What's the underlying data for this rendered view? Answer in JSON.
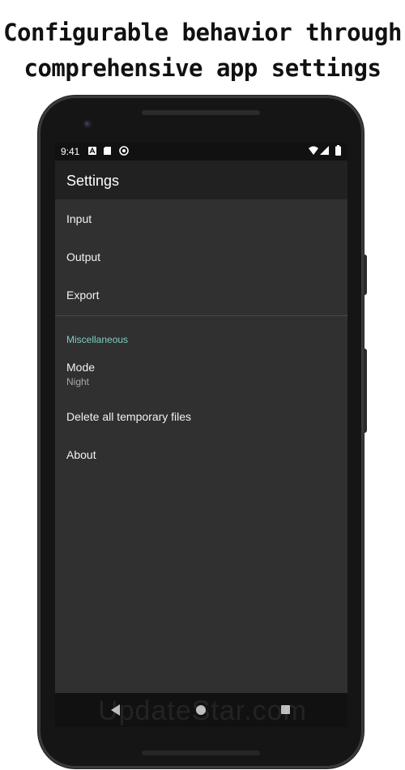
{
  "headline": {
    "line1": "Configurable behavior through",
    "line2": "comprehensive app settings"
  },
  "status_bar": {
    "time": "9:41",
    "left_icons": [
      "a-notification-icon",
      "sd-card-icon",
      "sync-icon"
    ],
    "right_icons": [
      "wifi-icon",
      "signal-icon",
      "battery-icon"
    ]
  },
  "app_bar": {
    "title": "Settings"
  },
  "settings": {
    "items": [
      {
        "label": "Input"
      },
      {
        "label": "Output"
      },
      {
        "label": "Export"
      }
    ],
    "misc_category": "Miscellaneous",
    "misc_items": [
      {
        "label": "Mode",
        "summary": "Night"
      },
      {
        "label": "Delete all temporary files"
      },
      {
        "label": "About"
      }
    ]
  },
  "watermark": "UpdateStar.com",
  "colors": {
    "background": "#303030",
    "app_bar": "#212121",
    "accent": "#80cbc4",
    "text_primary": "#f2f2f2",
    "text_secondary": "#a8a8a8"
  }
}
